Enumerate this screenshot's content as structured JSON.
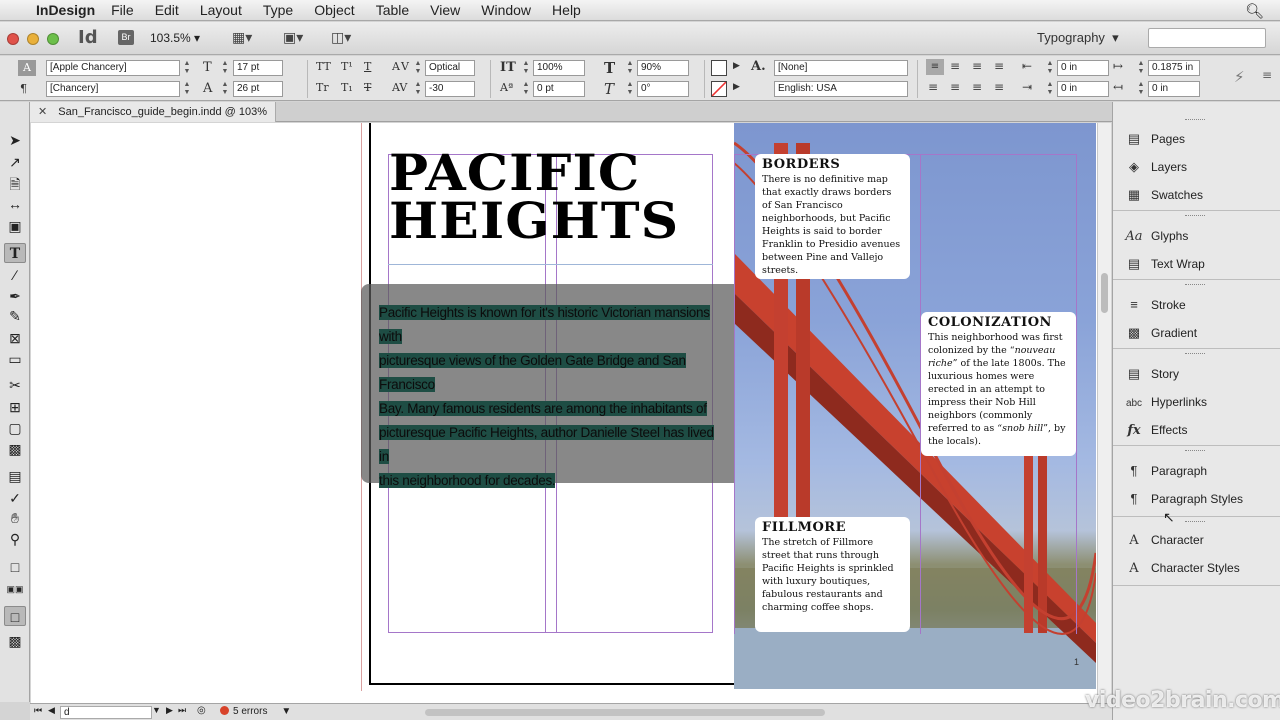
{
  "menubar": {
    "app": "InDesign",
    "items": [
      "File",
      "Edit",
      "Layout",
      "Type",
      "Object",
      "Table",
      "View",
      "Window",
      "Help"
    ]
  },
  "appbar": {
    "id_logo": "Id",
    "br_logo": "Br",
    "zoom": "103.5%",
    "workspace": "Typography"
  },
  "control": {
    "font_family": "[Apple Chancery]",
    "font_style": "[Chancery]",
    "font_size": "17 pt",
    "leading": "26 pt",
    "kerning": "Optical",
    "tracking": "-30",
    "vscale": "100%",
    "baseline": "0 pt",
    "hscale": "90%",
    "skew": "0°",
    "char_style": "[None]",
    "language": "English: USA",
    "left_indent": "0 in",
    "right_indent": "0 in",
    "first_line_indent": "0.1875 in",
    "last_line_indent": "0 in"
  },
  "document": {
    "tab_label": "San_Francisco_guide_begin.indd @ 103%"
  },
  "page": {
    "title_line1": "PACIFIC",
    "title_line2": "HEIGHTS",
    "body_lines": [
      "Pacific Heights is known for it's historic Victorian mansions with",
      "picturesque views of the Golden Gate Bridge and San Francisco",
      "Bay. Many famous residents are among the inhabitants of",
      "picturesque Pacific Heights, author Danielle Steel has lived in",
      "this neighborhood for decades."
    ]
  },
  "sidebars": {
    "borders": {
      "heading": "BORDERS",
      "text": "There is no definitive map that exactly draws borders of San Francisco neighborhoods, but Pacific Heights is said to border Franklin to Presidio avenues between Pine and Vallejo streets."
    },
    "colonization": {
      "heading": "COLONIZATION",
      "text_before": "This neighborhood was first colonized by the “",
      "text_em1": "nouveau riche",
      "text_mid": "” of the late 1800s. The luxurious homes were erected in an attempt to impress their Nob Hill neighbors (commonly referred to as “",
      "text_em2": "snob hill",
      "text_after": "”, by the locals)."
    },
    "fillmore": {
      "heading": "FILLMORE",
      "text": "The stretch of Fillmore street that runs through Pacific Heights is sprinkled with luxury boutiques, fabulous restaurants and charming coffee shops."
    }
  },
  "panels": {
    "items": [
      {
        "label": "Pages",
        "icon": "pages-icon"
      },
      {
        "label": "Layers",
        "icon": "layers-icon"
      },
      {
        "label": "Swatches",
        "icon": "swatches-icon"
      },
      {
        "label": "Glyphs",
        "icon": "glyphs-icon"
      },
      {
        "label": "Text Wrap",
        "icon": "text-wrap-icon"
      },
      {
        "label": "Stroke",
        "icon": "stroke-icon"
      },
      {
        "label": "Gradient",
        "icon": "gradient-icon"
      },
      {
        "label": "Story",
        "icon": "story-icon"
      },
      {
        "label": "Hyperlinks",
        "icon": "hyperlinks-icon"
      },
      {
        "label": "Effects",
        "icon": "effects-icon"
      },
      {
        "label": "Paragraph",
        "icon": "paragraph-icon"
      },
      {
        "label": "Paragraph Styles",
        "icon": "paragraph-styles-icon"
      },
      {
        "label": "Character",
        "icon": "character-icon"
      },
      {
        "label": "Character Styles",
        "icon": "character-styles-icon"
      }
    ]
  },
  "status": {
    "page_field": "d",
    "errors": "5 errors",
    "page_number": "1"
  },
  "watermark": "video2brain.com",
  "colors": {
    "text_highlight": "#1e4d44",
    "guide": "#a576c9",
    "error_dot": "#d8432a"
  }
}
